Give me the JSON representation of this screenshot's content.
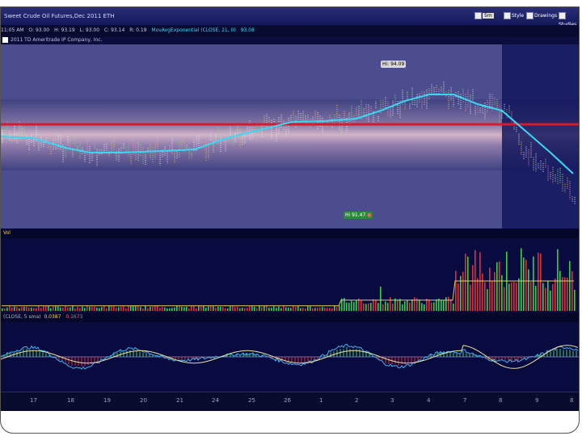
{
  "window": {
    "title": "Sweet Crude Oil Futures,Dec 2011 ETH"
  },
  "toolbar": {
    "time_label": "5m",
    "style_label": "Style",
    "drawings_label": "Drawings",
    "studies_label": "Studies"
  },
  "quote": {
    "time": "11:05 AM",
    "open": "O: 93.00",
    "high": "H: 93.19",
    "low": "L: 93.00",
    "close": "C: 93.14",
    "range": "R: 0.19",
    "study": "MovAvgExponential (CLOSE, 21, 0)",
    "study_value": "93.08"
  },
  "copyright": "2011 TD Ameritrade IP Company, Inc.",
  "price_chart": {
    "high_label": "Hi: 94.09",
    "last_label": "Hi 91.47",
    "colors": {
      "ema": "#39d8f2",
      "reference_line": "#d81a2a",
      "bars": "#d8d8f0",
      "background": "#0b0d3c"
    }
  },
  "volume_panel": {
    "label": "Vol"
  },
  "osc_panel": {
    "label": "(CLOSE, 5 sma)",
    "value1": "0.0387",
    "value2": "0.1673"
  },
  "x_axis": {
    "ticks": [
      "17",
      "18",
      "19",
      "20",
      "21",
      "24",
      "25",
      "26",
      "1",
      "2",
      "3",
      "4",
      "7",
      "8",
      "9",
      "8"
    ]
  }
}
